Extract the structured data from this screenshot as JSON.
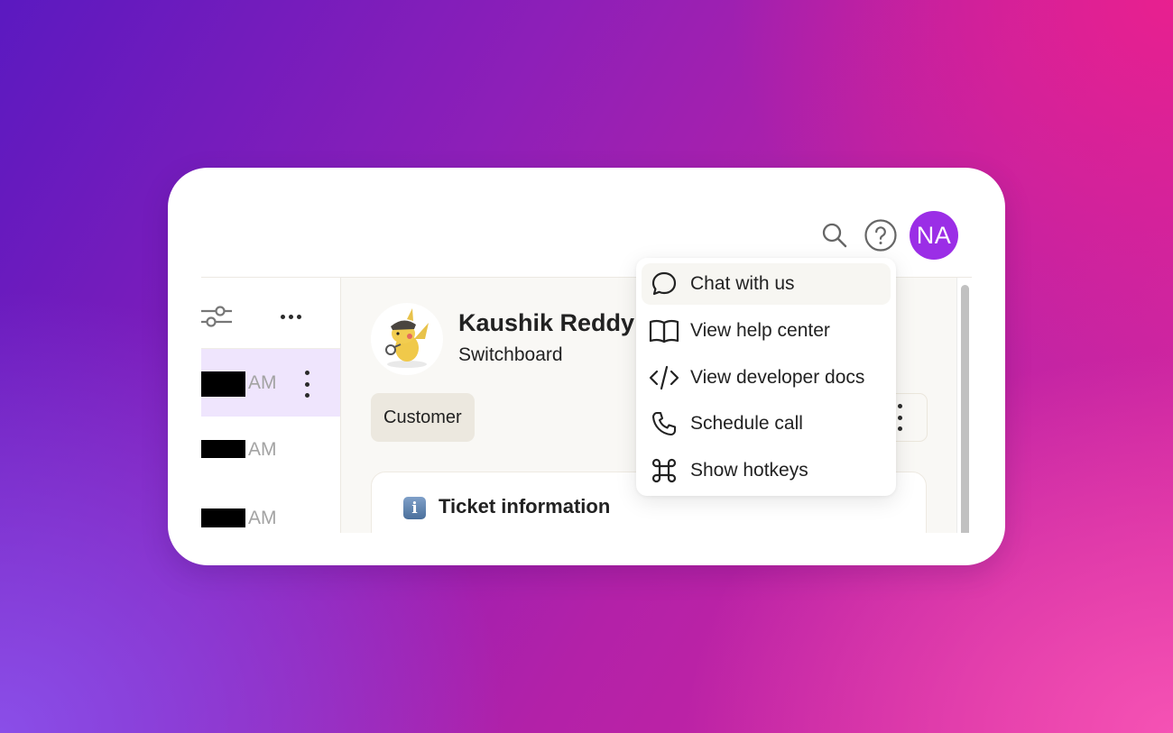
{
  "topbar": {
    "search_icon": "search-icon",
    "help_icon": "help-circle-icon",
    "user_initials": "NA",
    "avatar_color": "#9b2ee6"
  },
  "list": {
    "toolbar": {
      "filter_icon": "sliders-icon",
      "more_icon": "more-horizontal-icon"
    },
    "rows": [
      {
        "time": "AM",
        "selected": true
      },
      {
        "time": "AM",
        "selected": false
      },
      {
        "time": "AM",
        "selected": false
      }
    ]
  },
  "contact": {
    "name": "Kaushik Reddy",
    "company": "Switchboard",
    "badge": "Customer",
    "avatar": "pikachu-detective-avatar"
  },
  "ticket": {
    "section_title": "Ticket information",
    "icon": "info-icon"
  },
  "help_menu": {
    "items": [
      {
        "label": "Chat with us",
        "icon": "chat-bubble-icon",
        "highlighted": true
      },
      {
        "label": "View help center",
        "icon": "book-icon",
        "highlighted": false
      },
      {
        "label": "View developer docs",
        "icon": "code-icon",
        "highlighted": false
      },
      {
        "label": "Schedule call",
        "icon": "phone-icon",
        "highlighted": false
      },
      {
        "label": "Show hotkeys",
        "icon": "command-key-icon",
        "highlighted": false
      }
    ]
  },
  "colors": {
    "selected_row": "#efe5fd",
    "detail_bg": "#f9f8f5",
    "badge_bg": "#ece8df",
    "menu_highlight": "#f7f6f2"
  }
}
